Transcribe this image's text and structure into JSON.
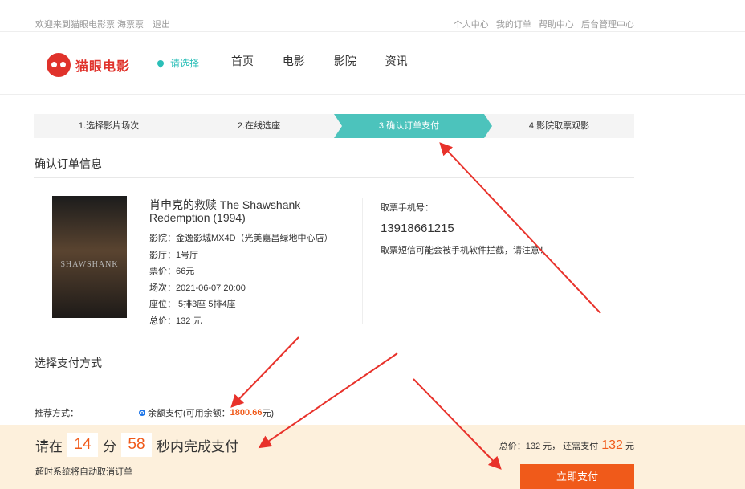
{
  "topbar": {
    "welcome": "欢迎来到猫眼电影票 海票票",
    "logout": "退出",
    "links": [
      "个人中心",
      "我的订单",
      "帮助中心",
      "后台管理中心"
    ]
  },
  "header": {
    "logo_text": "猫眼电影",
    "city": "请选择",
    "nav": [
      "首页",
      "电影",
      "影院",
      "资讯"
    ]
  },
  "steps": [
    "1.选择影片场次",
    "2.在线选座",
    "3.确认订单支付",
    "4.影院取票观影"
  ],
  "order": {
    "section_title": "确认订单信息",
    "poster_text": "SHAWSHANK",
    "movie_title": "肖申克的救赎 The Shawshank Redemption (1994)",
    "cinema": "影院：金逸影城MX4D（光美嘉昌绿地中心店）",
    "hall": "影厅：1号厅",
    "price": "票价：66元",
    "showtime": "场次：2021-06-07 20:00",
    "seats": "座位： 5排3座 5排4座",
    "total": "总价：132 元",
    "phone_label": "取票手机号：",
    "phone": "13918661215",
    "phone_note": "取票短信可能会被手机软件拦截，请注意！"
  },
  "payment": {
    "section_title": "选择支付方式",
    "label": "推荐方式：",
    "option": "余额支付(可用余额：",
    "balance": "1800.66",
    "option_end": "元)"
  },
  "bottom": {
    "prefix": "请在",
    "minutes": "14",
    "min_unit": "分",
    "seconds": "58",
    "suffix": "秒内完成支付",
    "hint": "超时系统将自动取消订单",
    "total_text": "总价：132 元， 还需支付",
    "due": "132",
    "due_unit": "元",
    "pay_button": "立即支付"
  },
  "colors": {
    "accent": "#4cc3bc",
    "orange": "#f05a1a",
    "brand": "#e0322b",
    "arrow": "#e8322b"
  }
}
